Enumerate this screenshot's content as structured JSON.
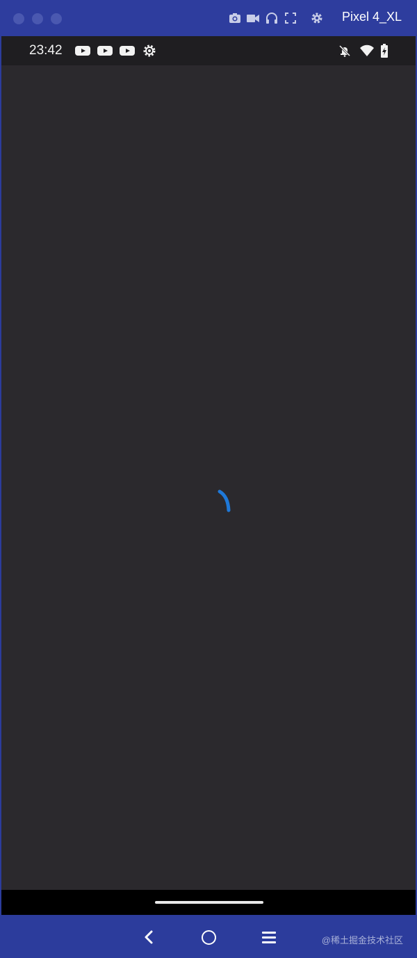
{
  "emulator": {
    "device_name": "Pixel 4_XL",
    "accent_color": "#2e3d9e"
  },
  "status_bar": {
    "time": "23:42",
    "notification_icons": [
      "youtube-icon",
      "youtube-icon",
      "youtube-icon",
      "settings-gear-icon"
    ],
    "system_icons": [
      "notifications-off-icon",
      "wifi-icon",
      "battery-charging-icon"
    ]
  },
  "app": {
    "background_color": "#2b292d",
    "spinner_color": "#1e78d8"
  },
  "bottom_toolbar": {
    "buttons": [
      "back-icon",
      "home-icon",
      "menu-icon"
    ],
    "watermark": "@稀土掘金技术社区"
  }
}
